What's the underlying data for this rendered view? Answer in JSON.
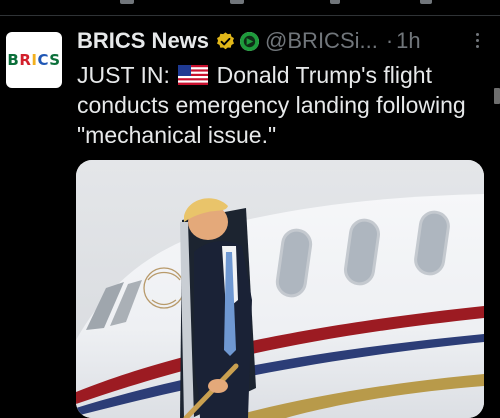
{
  "tweet": {
    "author": {
      "avatar_text": [
        "B",
        "R",
        "I",
        "C",
        "S"
      ],
      "display_name": "BRICS News",
      "handle": "@BRICSi...",
      "separator": "·",
      "time": "1h"
    },
    "text": {
      "prefix": "JUST IN:",
      "flag_icon": "us-flag-icon",
      "body": "Donald Trump's flight conducts emergency landing following \"mechanical issue.\""
    },
    "media": {
      "alt": "Donald Trump stepping out of an aircraft door"
    }
  },
  "colors": {
    "background": "#000000",
    "text": "#e7e9ea",
    "secondary_text": "#71767b",
    "verified_gold": "#e2b719",
    "affiliate_green": "#1d9b3b"
  }
}
